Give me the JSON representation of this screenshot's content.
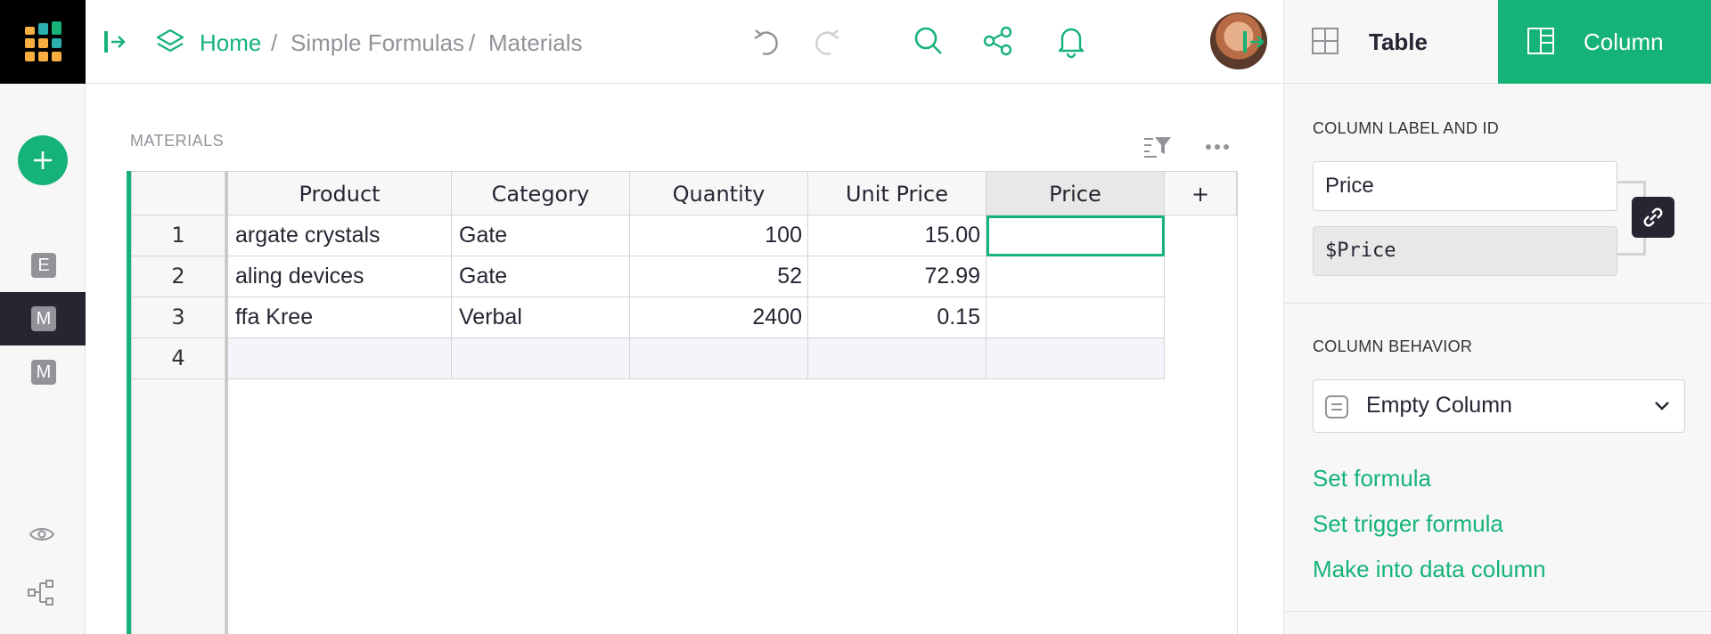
{
  "app": {
    "logo_icon": "grist-logo-icon",
    "accent_color": "#16b378"
  },
  "breadcrumb": {
    "home": "Home",
    "sep1": "/",
    "document": "Simple Formulas",
    "sep2": "/",
    "page": "Materials"
  },
  "leftnav": {
    "pages": [
      {
        "letter": "E",
        "selected": false
      },
      {
        "letter": "M",
        "selected": true
      },
      {
        "letter": "M",
        "selected": false
      }
    ]
  },
  "section": {
    "title": "MATERIALS"
  },
  "grid": {
    "columns": [
      "Product",
      "Category",
      "Quantity",
      "Unit Price",
      "Price"
    ],
    "add_column": "+",
    "rows": [
      {
        "num": "1",
        "product": "argate crystals",
        "category": "Gate",
        "quantity": "100",
        "unit_price": "15.00",
        "price": ""
      },
      {
        "num": "2",
        "product": "aling devices",
        "category": "Gate",
        "quantity": "52",
        "unit_price": "72.99",
        "price": ""
      },
      {
        "num": "3",
        "product": "ffa Kree",
        "category": "Verbal",
        "quantity": "2400",
        "unit_price": "0.15",
        "price": ""
      },
      {
        "num": "4",
        "product": "",
        "category": "",
        "quantity": "",
        "unit_price": "",
        "price": ""
      }
    ]
  },
  "right_panel": {
    "tabs": {
      "table": "Table",
      "column": "Column"
    },
    "label_section": "COLUMN LABEL AND ID",
    "label_value": "Price",
    "id_value": "$Price",
    "behavior_section": "COLUMN BEHAVIOR",
    "behavior_value": "Empty Column",
    "links": {
      "set_formula": "Set formula",
      "set_trigger": "Set trigger formula",
      "make_data": "Make into data column"
    }
  }
}
